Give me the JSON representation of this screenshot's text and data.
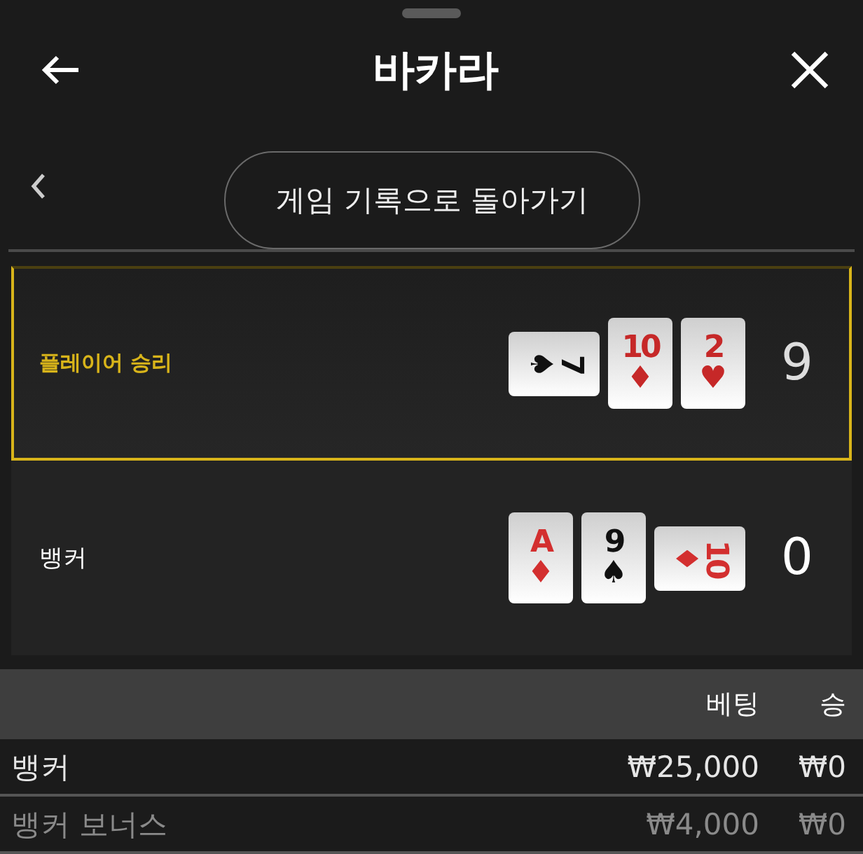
{
  "header": {
    "title": "바카라"
  },
  "back_button": {
    "label": "게임 기록으로 돌아가기"
  },
  "hands": [
    {
      "name": "플레이어 승리",
      "selected": true,
      "total": "9",
      "cards": [
        {
          "rank": "7",
          "suit": "♠",
          "color": "#111111",
          "rotated": true
        },
        {
          "rank": "10",
          "suit": "♦",
          "color": "#c62828",
          "rotated": false
        },
        {
          "rank": "2",
          "suit": "♥",
          "color": "#c62828",
          "rotated": false
        }
      ]
    },
    {
      "name": "뱅커",
      "selected": false,
      "total": "0",
      "cards": [
        {
          "rank": "A",
          "suit": "♦",
          "color": "#d32f2f",
          "rotated": false
        },
        {
          "rank": "9",
          "suit": "♠",
          "color": "#111111",
          "rotated": false
        },
        {
          "rank": "10",
          "suit": "♦",
          "color": "#d32f2f",
          "rotated": true
        }
      ]
    }
  ],
  "bets_table": {
    "columns": [
      "베팅",
      "승"
    ],
    "rows": [
      {
        "name": "뱅커",
        "bet": "₩25,000",
        "win": "₩0",
        "muted": false
      },
      {
        "name": "뱅커 보너스",
        "bet": "₩4,000",
        "win": "₩0",
        "muted": true
      }
    ]
  }
}
